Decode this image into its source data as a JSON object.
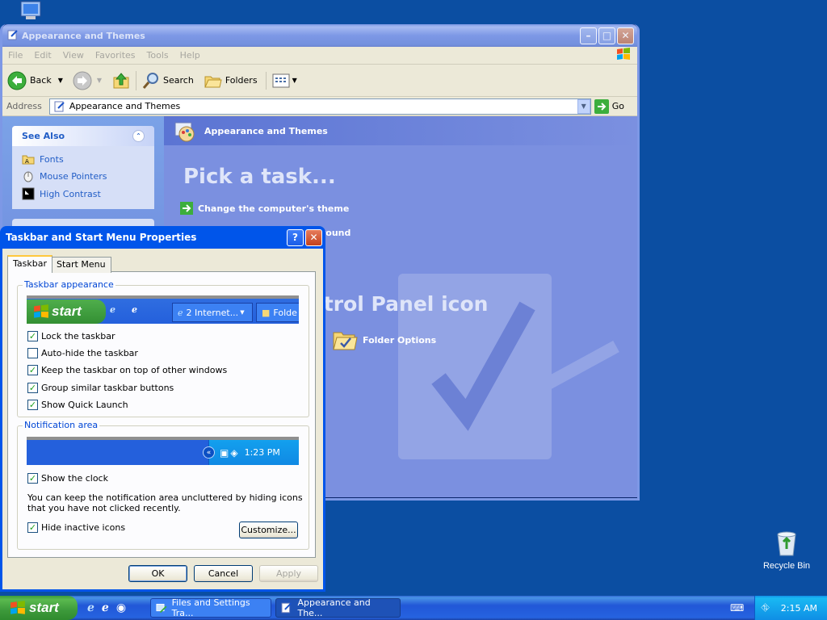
{
  "desktop": {
    "recycle_bin_label": "Recycle Bin"
  },
  "explorer": {
    "title": "Appearance and Themes",
    "menu": [
      "File",
      "Edit",
      "View",
      "Favorites",
      "Tools",
      "Help"
    ],
    "toolbar": {
      "back": "Back",
      "search": "Search",
      "folders": "Folders"
    },
    "address": {
      "label": "Address",
      "value": "Appearance and Themes",
      "go": "Go"
    },
    "see_also": {
      "title": "See Also",
      "items": [
        "Fonts",
        "Mouse Pointers",
        "High Contrast"
      ]
    },
    "header_title": "Appearance and Themes",
    "pick_task": "Pick a task...",
    "tasks": [
      "Change the computer's theme",
      "ground"
    ],
    "control_panel_icon_partial": "ntrol Panel icon",
    "folder_options": "Folder Options",
    "partial_u": "u"
  },
  "dialog": {
    "title": "Taskbar and Start Menu Properties",
    "tabs": [
      "Taskbar",
      "Start Menu"
    ],
    "taskbar_appearance": {
      "label": "Taskbar appearance",
      "preview_start": "start",
      "preview_task1": "2 Internet...",
      "preview_task2": "Folde",
      "options": [
        {
          "label": "Lock the taskbar",
          "checked": true
        },
        {
          "label": "Auto-hide the taskbar",
          "checked": false
        },
        {
          "label": "Keep the taskbar on top of other windows",
          "checked": true
        },
        {
          "label": "Group similar taskbar buttons",
          "checked": true
        },
        {
          "label": "Show Quick Launch",
          "checked": true
        }
      ]
    },
    "notification_area": {
      "label": "Notification area",
      "preview_time": "1:23 PM",
      "show_clock": "Show the clock",
      "description": "You can keep the notification area uncluttered by hiding icons that you have not clicked recently.",
      "hide_inactive": "Hide inactive icons",
      "customize": "Customize..."
    },
    "buttons": {
      "ok": "OK",
      "cancel": "Cancel",
      "apply": "Apply"
    }
  },
  "taskbar": {
    "start": "start",
    "tasks": [
      "Files and Settings Tra...",
      "Appearance and The..."
    ],
    "time": "2:15 AM"
  },
  "colors": {
    "xp_blue": "#0055ea",
    "desktop": "#0b4ea2",
    "start_green": "#3d9a3b",
    "check_green": "#21a121"
  }
}
